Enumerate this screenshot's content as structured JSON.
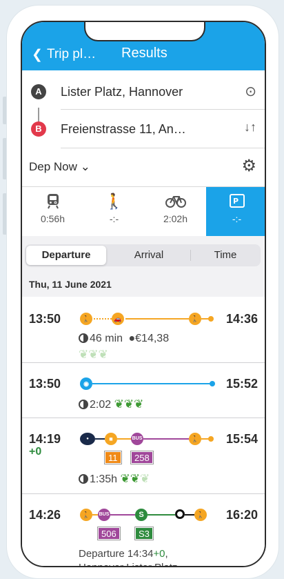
{
  "header": {
    "back_label": "Trip pl…",
    "title": "Results"
  },
  "route": {
    "origin_pin": "A",
    "origin": "Lister Platz, Hannover",
    "dest_pin": "B",
    "destination": "Freienstrasse 11, An…",
    "departure": "Dep Now"
  },
  "modes": [
    {
      "label": "0:56h",
      "icon": "train-icon"
    },
    {
      "label": "-:-",
      "icon": "walk-icon"
    },
    {
      "label": "2:02h",
      "icon": "bike-icon"
    },
    {
      "label": "-:-",
      "icon": "park-ride-icon",
      "active": true
    }
  ],
  "segments": {
    "departure": "Departure",
    "arrival": "Arrival",
    "time": "Time",
    "selected": "Departure"
  },
  "date": "Thu, 11 June 2021",
  "trips": [
    {
      "dep": "13:50",
      "arr": "14:36",
      "duration": "46 min",
      "price": "€14,38",
      "leaves_active": 0
    },
    {
      "dep": "13:50",
      "arr": "15:52",
      "duration": "2:02",
      "leaves_active": 3
    },
    {
      "dep": "14:19",
      "delay": "+0",
      "arr": "15:54",
      "duration": "1:35h",
      "line_tram": "11",
      "line_bus": "258",
      "leaves_active": 2
    },
    {
      "dep": "14:26",
      "arr": "16:20",
      "line_bus": "506",
      "line_sbahn": "S3",
      "note_prefix": "Departure 14:34",
      "note_delay": "+0",
      "note_comma": ",",
      "note_stop": "Hannover Lister Platz"
    }
  ],
  "colors": {
    "accent": "#1ba3e8",
    "walk": "#f5a623",
    "bus": "#a0479a",
    "sbahn": "#2e8b3e",
    "bike": "#1ba3e8",
    "eco": "#3e9a34"
  }
}
